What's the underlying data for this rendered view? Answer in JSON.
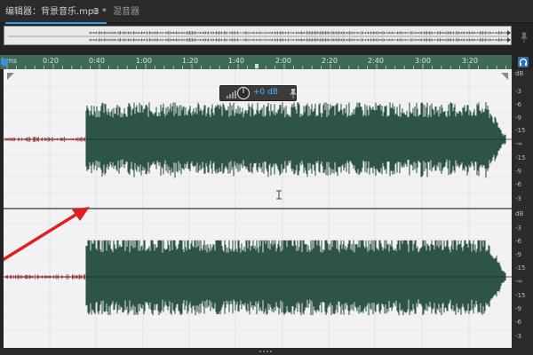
{
  "tabs": {
    "editor_label": "编辑器：背景音乐.mp3 *",
    "menu_glyph": "≡",
    "mixer_label": "混音器"
  },
  "ruler": {
    "labels": [
      "hms",
      "0:20",
      "0:40",
      "1:00",
      "1:20",
      "1:40",
      "2:00",
      "2:20",
      "2:40",
      "3:00",
      "3:20"
    ]
  },
  "hud": {
    "gain_label": "+0 dB"
  },
  "db_scale": {
    "upper": [
      "dB",
      "-3",
      "-6",
      "-9",
      "-15",
      "-∞",
      "-15",
      "-9",
      "-6",
      "-3"
    ],
    "lower": [
      "dB",
      "-3",
      "-6",
      "-9",
      "-15",
      "-∞",
      "-15",
      "-9",
      "-6",
      "-3"
    ]
  },
  "colors": {
    "waveform": "#2e5545",
    "ruler": "#3f6a55",
    "background": "#f2f2f4",
    "annotation_arrow": "#e02020",
    "accent": "#2f9ee8"
  },
  "icons": {
    "headphone": "headphone-icon",
    "pin": "pin-icon"
  }
}
